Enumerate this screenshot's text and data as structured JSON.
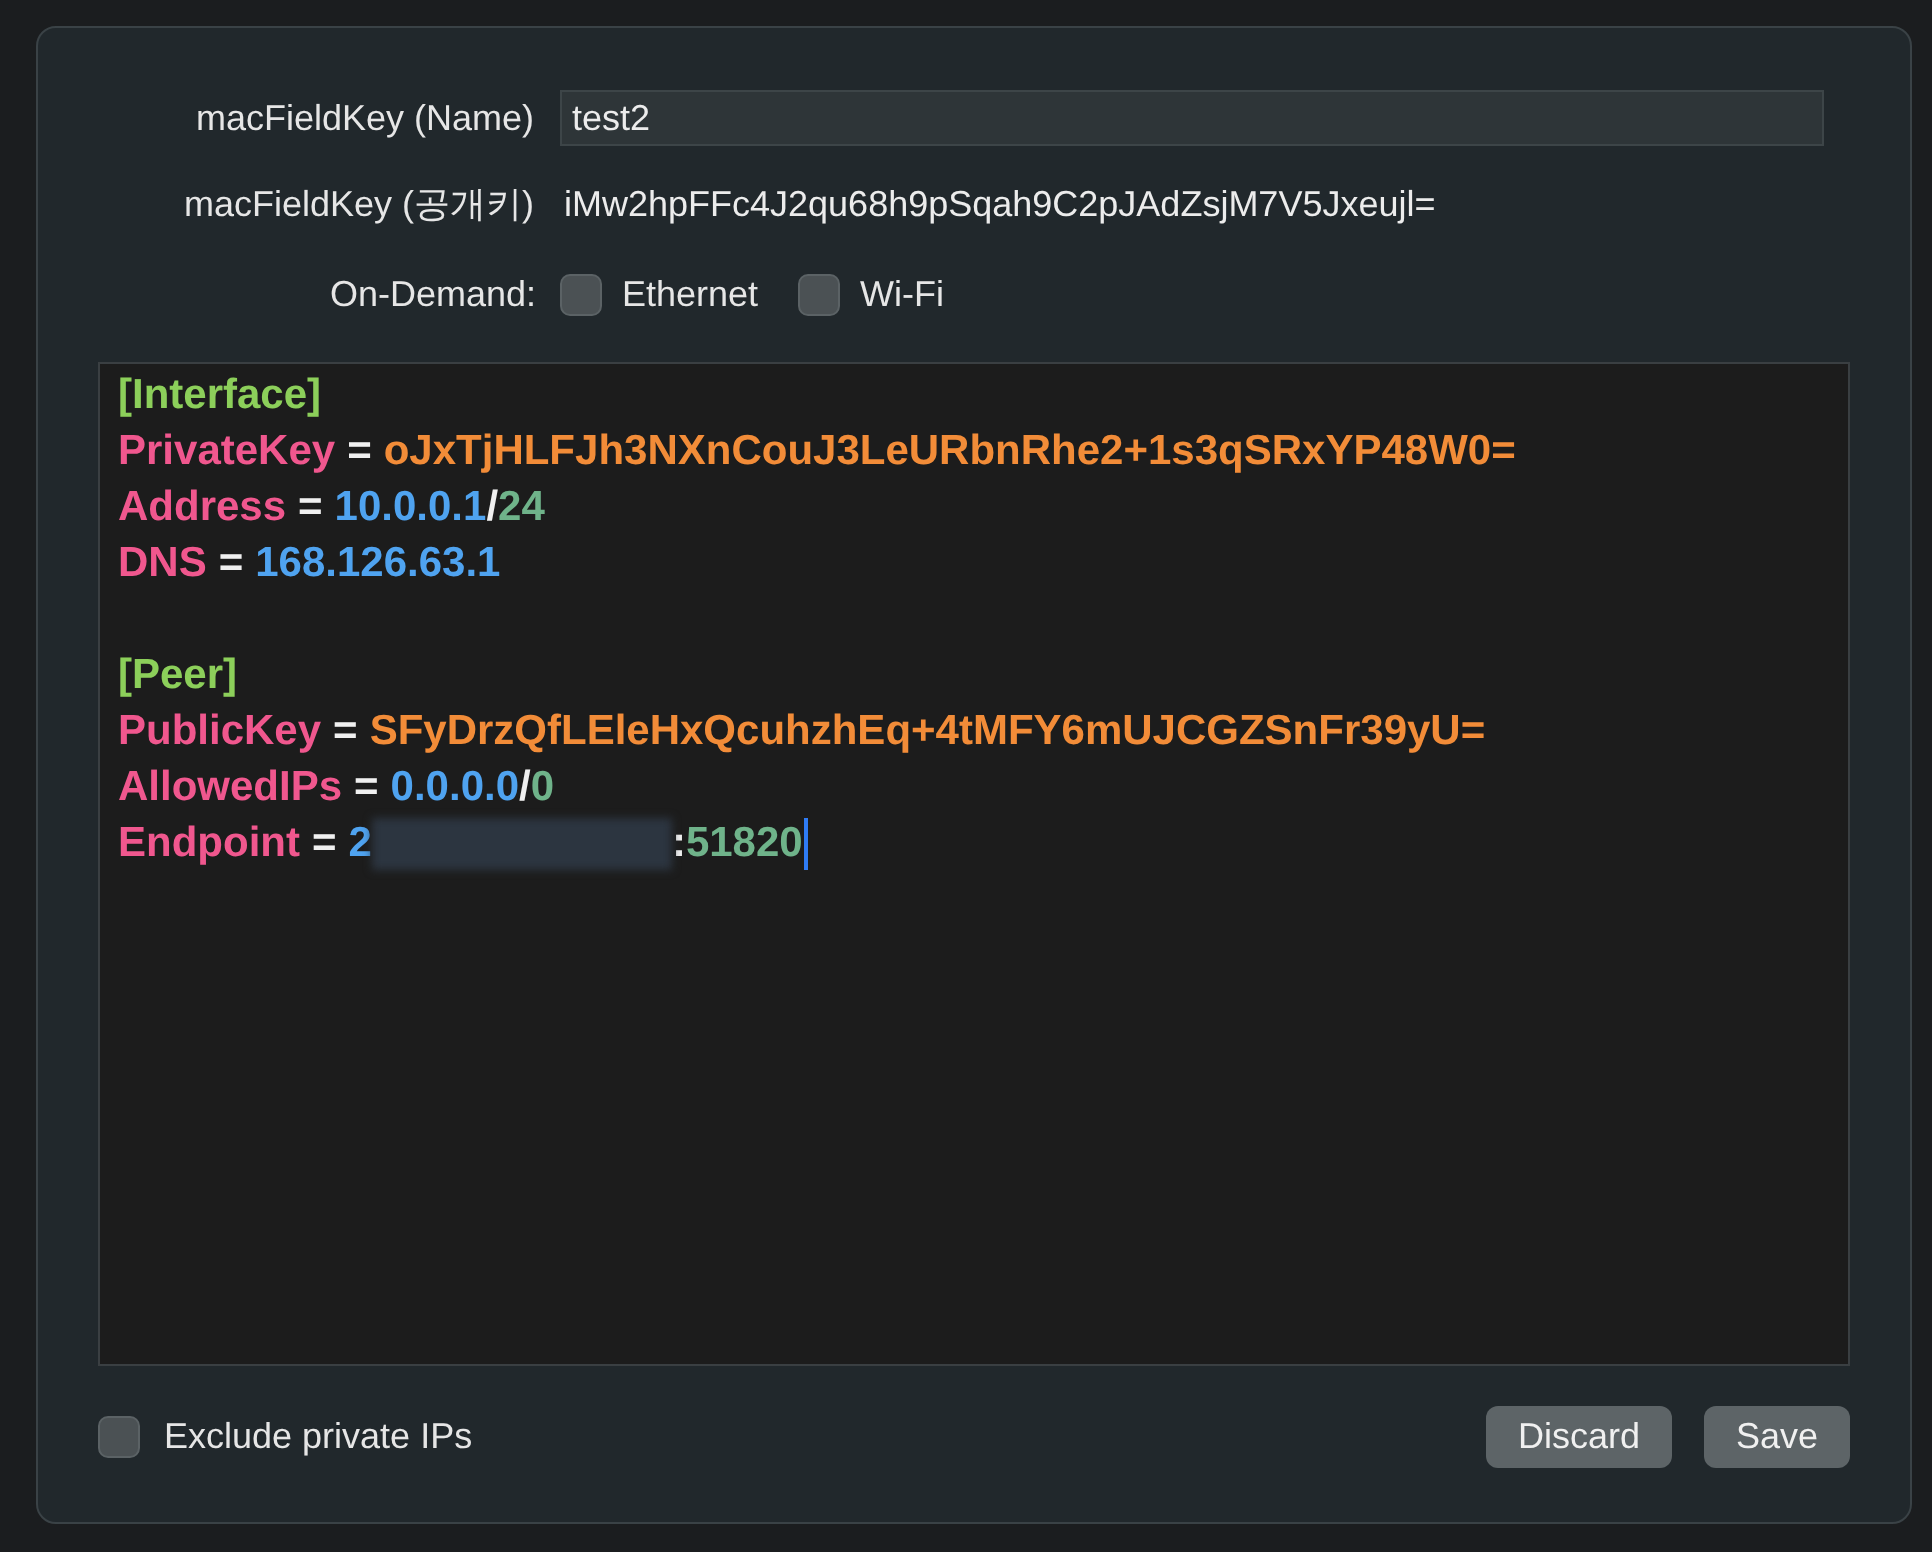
{
  "form": {
    "name_label": "macFieldKey (Name)",
    "name_value": "test2",
    "key_label": "macFieldKey (공개키)",
    "key_value": "iMw2hpFFc4J2qu68h9pSqah9C2pJAdZsjM7V5Jxeujl=",
    "on_demand_label": "On-Demand:",
    "on_demand": [
      {
        "label": "Ethernet",
        "checked": false
      },
      {
        "label": "Wi-Fi",
        "checked": false
      }
    ]
  },
  "editor": {
    "lines": [
      {
        "kind": "section",
        "text": "[Interface]"
      },
      {
        "kind": "pair",
        "key": "PrivateKey",
        "eq": "=",
        "segments": [
          {
            "kind": "string",
            "text": "oJxTjHLFJh3NXnCouJ3LeURbnRhe2+1s3qSRxYP48W0="
          }
        ]
      },
      {
        "kind": "pair",
        "key": "Address",
        "eq": "=",
        "segments": [
          {
            "kind": "ip",
            "text": "10.0.0.1"
          },
          {
            "kind": "punct",
            "text": "/"
          },
          {
            "kind": "number",
            "text": "24"
          }
        ]
      },
      {
        "kind": "pair",
        "key": "DNS",
        "eq": "=",
        "segments": [
          {
            "kind": "ip",
            "text": "168.126.63.1"
          }
        ]
      },
      {
        "kind": "blank"
      },
      {
        "kind": "section",
        "text": "[Peer]"
      },
      {
        "kind": "pair",
        "key": "PublicKey",
        "eq": "=",
        "segments": [
          {
            "kind": "string",
            "text": "SFyDrzQfLEleHxQcuhzhEq+4tMFY6mUJCGZSnFr39yU="
          }
        ]
      },
      {
        "kind": "pair",
        "key": "AllowedIPs",
        "eq": "=",
        "segments": [
          {
            "kind": "ip",
            "text": "0.0.0.0"
          },
          {
            "kind": "punct",
            "text": "/"
          },
          {
            "kind": "number",
            "text": "0"
          }
        ]
      },
      {
        "kind": "pair",
        "key": "Endpoint",
        "eq": "=",
        "cursor": true,
        "segments": [
          {
            "kind": "ip",
            "text": "2"
          },
          {
            "kind": "redacted"
          },
          {
            "kind": "punct",
            "text": ":"
          },
          {
            "kind": "number",
            "text": "51820"
          }
        ]
      }
    ]
  },
  "exclude_private_ips": {
    "label": "Exclude private IPs",
    "checked": false
  },
  "buttons": [
    "Discard",
    "Save"
  ]
}
